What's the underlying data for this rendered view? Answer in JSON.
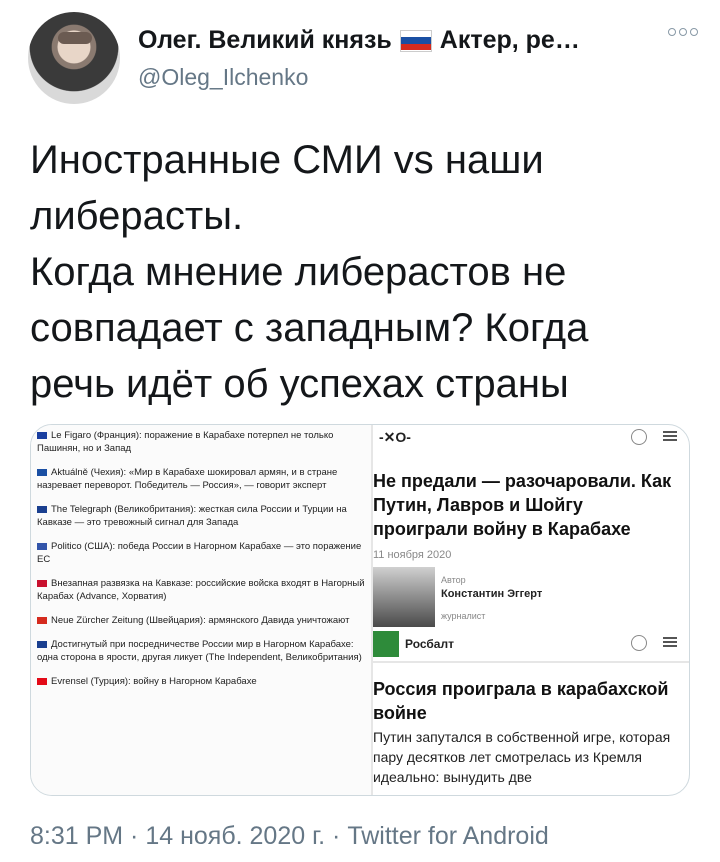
{
  "author": {
    "display_name": "Олег. Великий князь",
    "display_name_suffix": "Актер, ре…",
    "handle": "@Oleg_Ilchenko"
  },
  "icons": {
    "avatar": "user-avatar",
    "flag": "russia-flag-icon",
    "more": "more-options-icon"
  },
  "tweet": {
    "text": "Иностранные СМИ vs наши\nлиберасты.\nКогда мнение либерастов не\nсовпадает с западным? Когда\nречь идёт об успехах страны"
  },
  "media": {
    "left_items": [
      "Le Figaro (Франция): поражение в Карабахе потерпел не только Пашинян, но и Запад",
      "Aktuálně (Чехия): «Мир в Карабахе шокировал армян, и в стране назревает переворот. Победитель — Россия», — говорит эксперт",
      "The Telegraph (Великобритания): жесткая сила России и Турции на Кавказе — это тревожный сигнал для Запада",
      "Politico (США): победа России в Нагорном Карабахе — это поражение ЕС",
      "Внезапная развязка на Кавказе: российские войска входят в Нагорный Карабах (Advance, Хорватия)",
      "Neue Zürcher Zeitung (Швейцария): армянского Давида уничтожают",
      "Достигнутый при посредничестве России мир в Нагорном Карабахе: одна сторона в ярости, другая ликует (The Independent, Великобритания)",
      "Evrensel (Турция): войну в Нагорном Карабахе"
    ],
    "left_flag_colors": [
      "#1a3fa0",
      "#1a4fa3",
      "#1a3f8f",
      "#3355aa",
      "#c8102e",
      "#d52b1e",
      "#1a3f8f",
      "#e30a17"
    ],
    "right": {
      "logo_text": "-✕О-",
      "headline1": "Не предали — разочаровали. Как Путин, Лавров и Шойгу проиграли войну в Карабахе",
      "date1": "11 ноября 2020",
      "author_label": "Автор",
      "author_name": "Константин Эггерт",
      "author_role": "журналист",
      "source_name": "Росбалт",
      "headline2": "Россия проиграла в карабахской войне",
      "body2": "Путин запутался в собственной игре, которая пару десятков лет смотрелась из Кремля идеально: вынудить две"
    }
  },
  "footer": {
    "timestamp": "8:31 PM · 14 нояб. 2020 г. · Twitter for Android"
  }
}
